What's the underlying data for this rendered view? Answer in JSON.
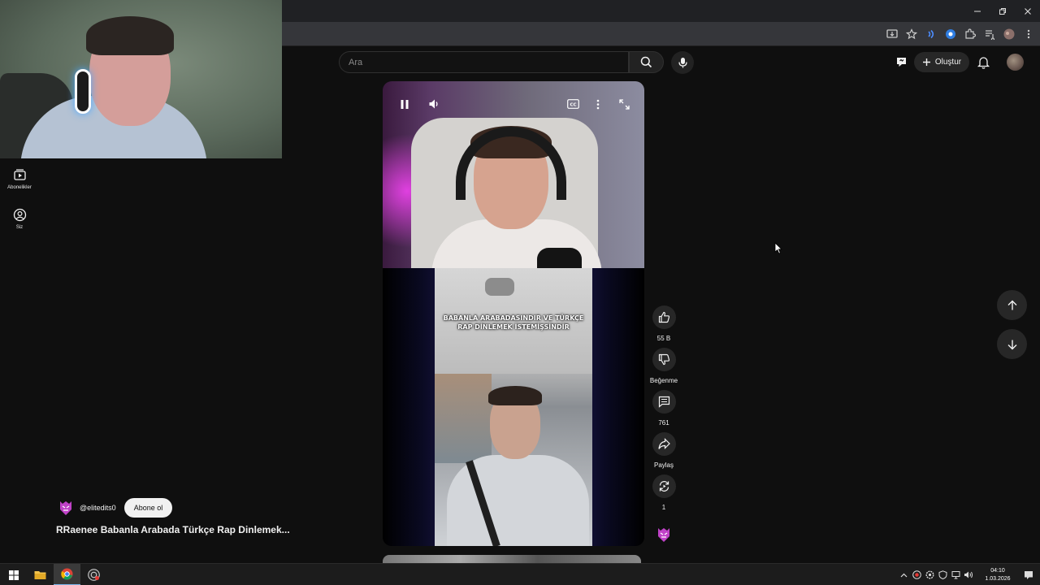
{
  "sidebar": {
    "items": [
      {
        "label": "Abonelikler",
        "icon": "subscriptions-icon"
      },
      {
        "label": "Siz",
        "icon": "you-icon"
      }
    ]
  },
  "masthead": {
    "search_placeholder": "Ara",
    "create_label": "Oluştur"
  },
  "short": {
    "overlay_text": "BABANLA ARABADASINDIR VE TÜRKÇE RAP DİNLEMEK İSTEMİŞSİNDİR",
    "channel_handle": "@elitedits0",
    "subscribe_label": "Abone ol",
    "title": "RRaenee Babanla Arabada Türkçe Rap Dinlemek..."
  },
  "actions": {
    "like_count": "55 B",
    "dislike_label": "Beğenme",
    "comment_count": "761",
    "share_label": "Paylaş",
    "remix_count": "1"
  },
  "taskbar": {
    "time": "04:10",
    "date": "1.03.2026"
  },
  "colors": {
    "background": "#0f0f0f",
    "button": "#272727",
    "accent_channel": "#c042c8"
  }
}
